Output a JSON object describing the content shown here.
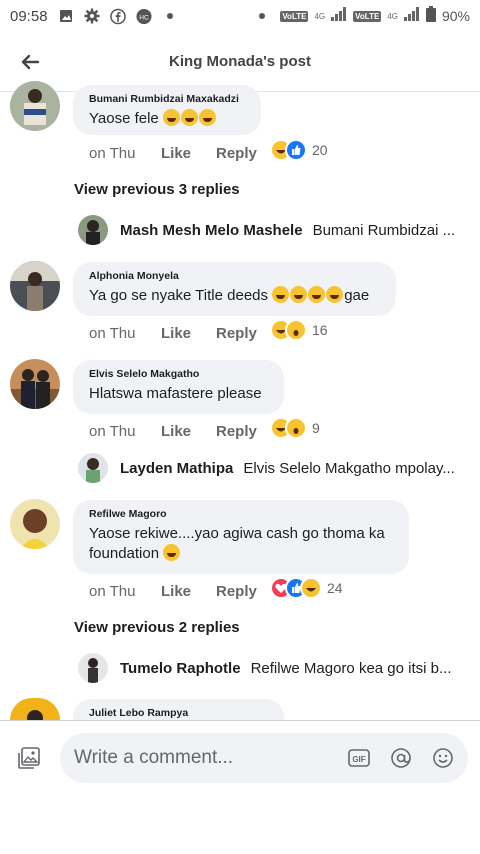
{
  "status_bar": {
    "time": "09:58",
    "volte1": "VoLTE",
    "net1": "4G",
    "volte2": "VoLTE",
    "net2": "4G",
    "battery": "90%"
  },
  "header": {
    "title": "King Monada's post"
  },
  "comments": [
    {
      "name": "Bumani Rumbidzai Maxakadzi",
      "text": "Yaose fele",
      "time": "on Thu",
      "like": "Like",
      "reply": "Reply",
      "reactions": "20"
    },
    {
      "name": "Alphonia Monyela",
      "text": "Ya go se nyake Title deeds",
      "text_suffix": "gae",
      "time": "on Thu",
      "like": "Like",
      "reply": "Reply",
      "reactions": "16"
    },
    {
      "name": "Elvis Selelo Makgatho",
      "text": "Hlatswa mafastere please",
      "time": "on Thu",
      "like": "Like",
      "reply": "Reply",
      "reactions": "9"
    },
    {
      "name": "Refilwe Magoro",
      "text": "Yaose rekiwe....yao agiwa cash go thoma ka foundation",
      "time": "on Thu",
      "like": "Like",
      "reply": "Reply",
      "reactions": "24"
    },
    {
      "name": "Juliet Lebo Rampya"
    }
  ],
  "previous_replies": [
    {
      "label": "View previous 3 replies"
    },
    {
      "label": "View previous 2 replies"
    }
  ],
  "replies": [
    {
      "name": "Mash Mesh Melo Mashele",
      "text": "Bumani Rumbidzai ..."
    },
    {
      "name": "Layden Mathipa",
      "text": "Elvis Selelo Makgatho mpolay..."
    },
    {
      "name": "Tumelo Raphotle",
      "text": "Refilwe Magoro kea go itsi b..."
    }
  ],
  "composer": {
    "placeholder": "Write a comment..."
  },
  "colors": {
    "like_blue": "#1877f2",
    "love_red": "#f33e58",
    "haha_yellow": "#f7c331",
    "bubble_bg": "#f0f2f5"
  }
}
